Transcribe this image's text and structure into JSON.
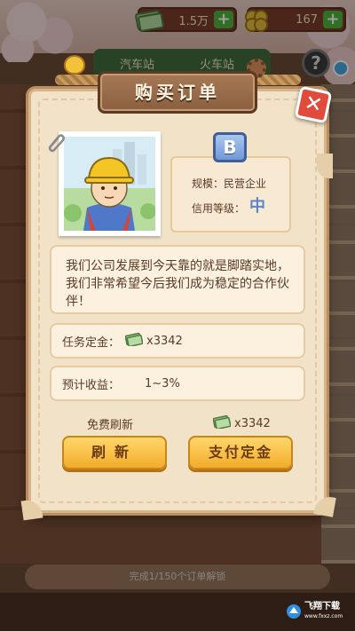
{
  "top_bar": {
    "money_value": "1.5万",
    "clover_value": "167",
    "plus_symbol": "+",
    "help_symbol": "?"
  },
  "background": {
    "tab_left_label": "汽车站",
    "tab_right_label": "火车站",
    "bottom_progress_text": "完成1/150个订单解锁",
    "watermark_text": "飞翔下载",
    "watermark_sub": "www.fxxz.com"
  },
  "modal": {
    "title": "购买订单",
    "close_symbol": "✕",
    "grade": "B",
    "scale_label": "规模：",
    "scale_value": "民营企业",
    "credit_label": "信用等级：",
    "credit_value": "中",
    "description": "我们公司发展到今天靠的就是脚踏实地，我们非常希望今后我们成为稳定的合作伙伴！",
    "deposit_label": "任务定金：",
    "deposit_value": "x3342",
    "income_label": "预计收益：",
    "income_value": "1~3%",
    "free_refresh_label": "免费刷新",
    "pay_cost_value": "x3342",
    "refresh_button": "刷新",
    "pay_button": "支付定金"
  },
  "colors": {
    "panel": "#f1e2c8",
    "button": "#f2ad2a",
    "close": "#e04b3c",
    "grade_badge": "#6f98d6"
  },
  "icons": [
    "cash-icon",
    "clover-icon",
    "help-icon",
    "close-icon",
    "paperclip-icon",
    "gear-icon",
    "chick-icon"
  ]
}
